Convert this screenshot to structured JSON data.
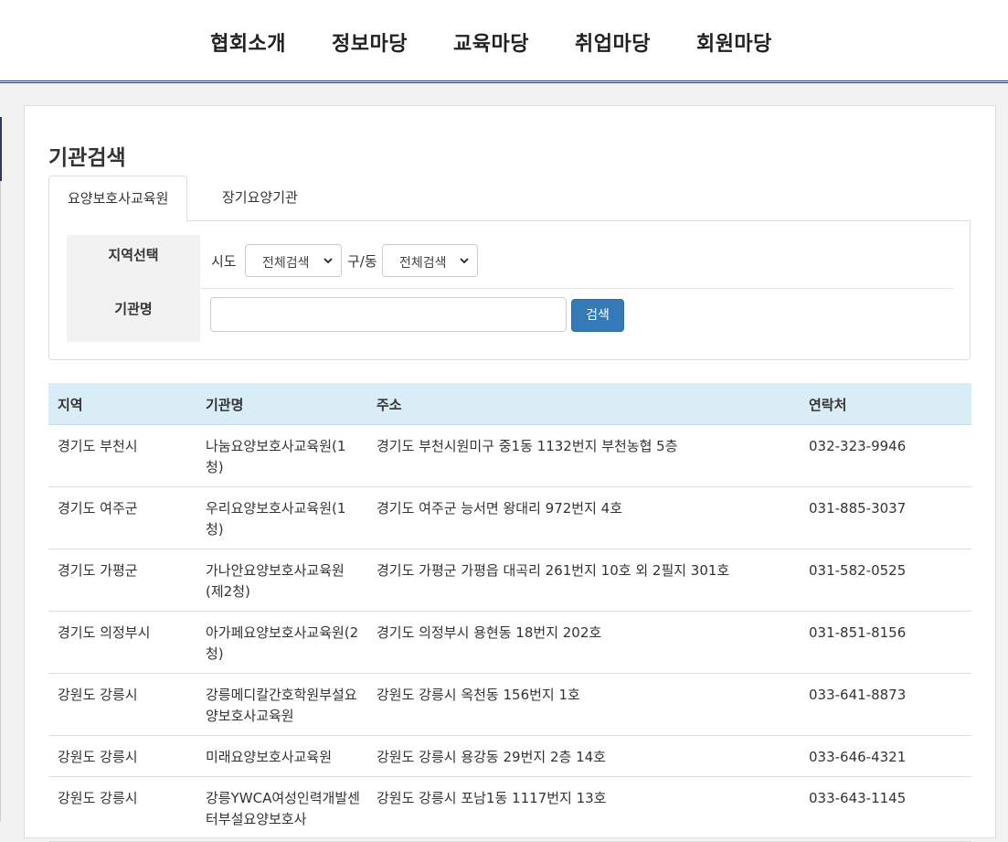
{
  "nav": {
    "items": [
      "협회소개",
      "정보마당",
      "교육마당",
      "취업마당",
      "회원마당"
    ]
  },
  "page": {
    "title": "기관검색"
  },
  "tabs": [
    "요양보호사교육원",
    "장기요양기관"
  ],
  "search": {
    "region_label": "지역선택",
    "sido_label": "시도",
    "sido_value": "전체검색",
    "gudong_label": "구/동",
    "gudong_value": "전체검색",
    "name_label": "기관명",
    "name_value": "",
    "button_label": "검색"
  },
  "table": {
    "headers": [
      "지역",
      "기관명",
      "주소",
      "연락처"
    ],
    "rows": [
      {
        "region": "경기도 부천시",
        "name": "나눔요양보호사교육원(1청)",
        "address": "경기도 부천시원미구 중1동 1132번지 부천농협 5층",
        "phone": "032-323-9946"
      },
      {
        "region": "경기도 여주군",
        "name": "우리요양보호사교육원(1청)",
        "address": "경기도 여주군 능서면 왕대리 972번지 4호",
        "phone": "031-885-3037"
      },
      {
        "region": "경기도 가평군",
        "name": "가나안요양보호사교육원(제2청)",
        "address": "경기도 가평군 가평읍 대곡리 261번지 10호 외 2필지 301호",
        "phone": "031-582-0525"
      },
      {
        "region": "경기도 의정부시",
        "name": "아가페요양보호사교육원(2청)",
        "address": "경기도 의정부시 용현동 18번지 202호",
        "phone": "031-851-8156"
      },
      {
        "region": "강원도 강릉시",
        "name": "강릉메디칼간호학원부설요양보호사교육원",
        "address": "강원도 강릉시 옥천동 156번지 1호",
        "phone": "033-641-8873"
      },
      {
        "region": "강원도 강릉시",
        "name": "미래요양보호사교육원",
        "address": "강원도 강릉시 용강동 29번지 2층 14호",
        "phone": "033-646-4321"
      },
      {
        "region": "강원도 강릉시",
        "name": "강릉YWCA여성인력개발센터부설요양보호사",
        "address": "강원도 강릉시 포남1동 1117번지 13호",
        "phone": "033-643-1145"
      }
    ]
  }
}
